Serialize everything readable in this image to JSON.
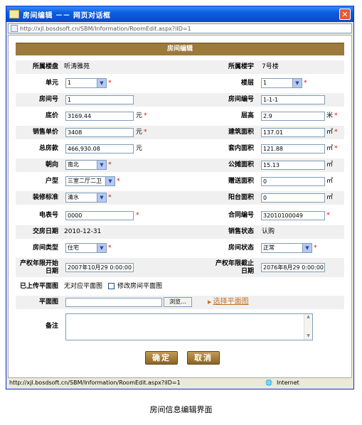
{
  "window": {
    "title": "房间编辑 －－ 网页对话框",
    "address": "http://xjl.bosdsoft.cn/SBM/Information/RoomEdit.aspx?iID=1",
    "status_url": "http://xjl.bosdsoft.cn/SBM/Information/RoomEdit.aspx?iID=1",
    "status_zone": "Internet"
  },
  "form": {
    "header": "房间编辑",
    "estate_label": "所属楼盘",
    "estate_value": "听涛雅苑",
    "building_label": "所属楼宇",
    "building_value": "7号楼",
    "unit_label": "单元",
    "unit_value": "1",
    "floor_label": "楼层",
    "floor_value": "1",
    "room_no_label": "房间号",
    "room_no_value": "1",
    "room_code_label": "房间编号",
    "room_code_value": "1-1-1",
    "base_price_label": "底价",
    "base_price_value": "3169.44",
    "base_price_unit": "元",
    "floor_height_label": "层高",
    "floor_height_value": "2.9",
    "floor_height_unit": "米",
    "sale_price_label": "销售单价",
    "sale_price_value": "3408",
    "sale_price_unit": "元",
    "build_area_label": "建筑面积",
    "build_area_value": "137.01",
    "area_unit": "㎡",
    "total_label": "总房款",
    "total_value": "466,930.08",
    "total_unit": "元",
    "inner_area_label": "套内面积",
    "inner_area_value": "121.88",
    "orientation_label": "朝向",
    "orientation_value": "南北",
    "shared_area_label": "公摊面积",
    "shared_area_value": "15.13",
    "layout_label": "户型",
    "layout_value": "三室二厅二卫",
    "gift_area_label": "赠送面积",
    "gift_area_value": "0",
    "decor_label": "装修标准",
    "decor_value": "清水",
    "balcony_area_label": "阳台面积",
    "balcony_area_value": "0",
    "meter_label": "电表号",
    "meter_value": "0000",
    "contract_label": "合同编号",
    "contract_value": "32010100049",
    "delivery_label": "交房日期",
    "delivery_value": "2010-12-31",
    "sale_status_label": "销售状态",
    "sale_status_value": "认购",
    "room_type_label": "房间类型",
    "room_type_value": "住宅",
    "room_status_label": "房间状态",
    "room_status_value": "正常",
    "prop_start_label": "产权年限开始日期",
    "prop_start_value": "2007年10月29 0:00:00",
    "prop_end_label": "产权年限截止日期",
    "prop_end_value": "2076年8月29 0:00:00",
    "uploaded_label": "已上传平面图",
    "uploaded_value": "无对应平面图",
    "modify_plan_label": "修改房间平面图",
    "plan_label": "平面图",
    "browse_label": "浏览...",
    "select_plan_label": "选择平面图",
    "remark_label": "备注",
    "ok_label": "确定",
    "cancel_label": "取消"
  },
  "caption": "房间信息编辑界面",
  "colors": {
    "header_bg": "#9c7a3c",
    "required": "#e00000",
    "link": "#c0722a"
  }
}
